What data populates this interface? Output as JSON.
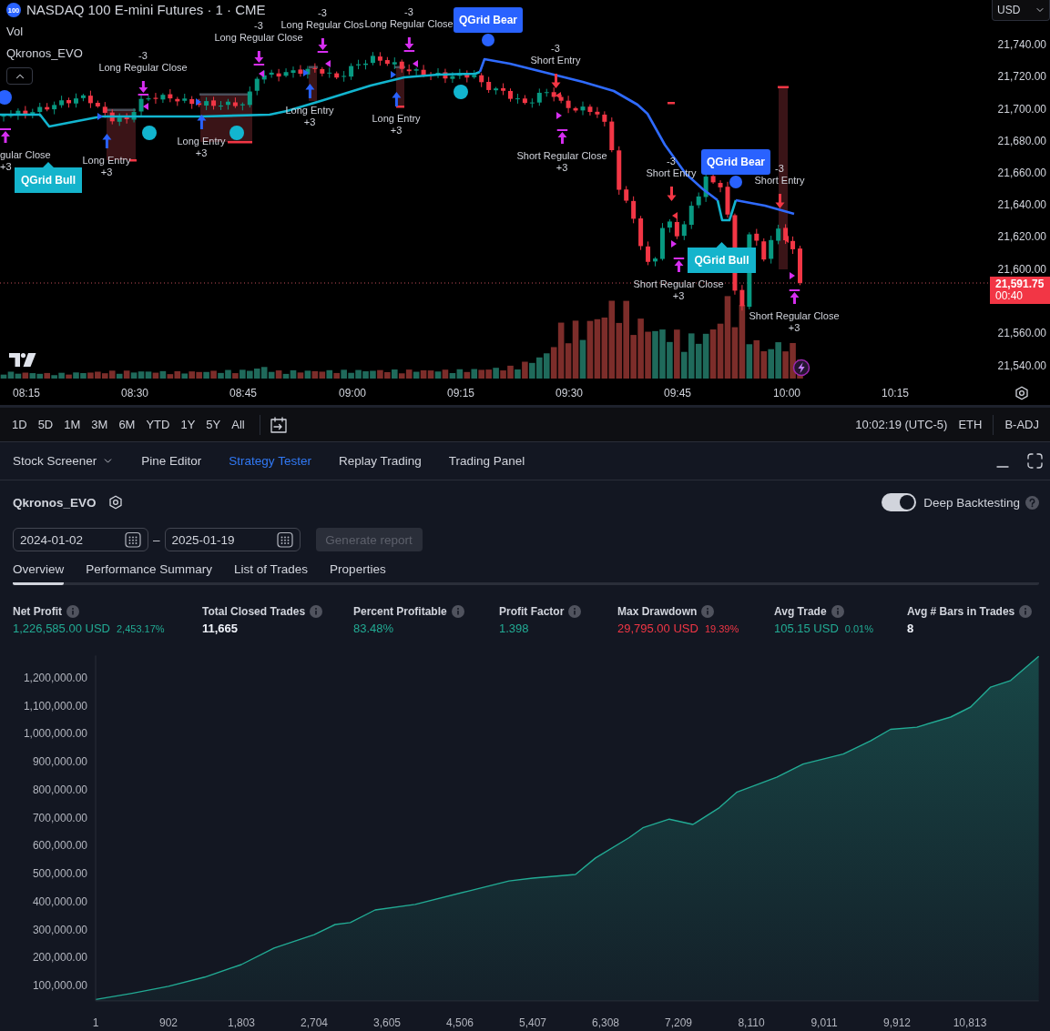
{
  "chart": {
    "symbol_badge": "100",
    "title": "NASDAQ 100 E-mini Futures · 1 · CME",
    "indicators": [
      "Vol",
      "Qkronos_EVO"
    ],
    "legend_toggle": {
      "expanded": true
    },
    "currency": "USD",
    "annotations": [
      {
        "kind": "long_close",
        "qty": "-3",
        "label": "Long Regular Clos"
      },
      {
        "kind": "long_close",
        "qty": "-3",
        "label": "Long Regular Close"
      },
      {
        "kind": "long_close",
        "qty": "-3",
        "label": "Long Regular Close"
      },
      {
        "kind": "short_entry",
        "qty": "-3",
        "label": "Short Entry"
      },
      {
        "kind": "long_close",
        "qty": "-3",
        "label": "Long Regular Close"
      },
      {
        "kind": "long_entry",
        "qty": "+3",
        "label": "Long Entry"
      },
      {
        "kind": "long_entry",
        "qty": "+3",
        "label": "Long Entry"
      },
      {
        "kind": "long_entry",
        "qty": "+3",
        "label": "Long Entry"
      },
      {
        "kind": "short_close",
        "qty": "+3",
        "label": "gular Close"
      },
      {
        "kind": "long_entry",
        "qty": "+3",
        "label": "Long Entry"
      },
      {
        "kind": "short_close",
        "qty": "+3",
        "label": "Short Regular Close"
      },
      {
        "kind": "short_entry",
        "qty": "-3",
        "label": "Short Entry"
      },
      {
        "kind": "short_entry",
        "qty": "-3",
        "label": "Short Entry"
      },
      {
        "kind": "short_close",
        "qty": "+3",
        "label": "Short Regular Close"
      },
      {
        "kind": "short_close",
        "qty": "+3",
        "label": "Short Regular Close"
      }
    ],
    "signals": [
      {
        "kind": "bear",
        "label": "QGrid Bear"
      },
      {
        "kind": "bear",
        "label": "QGrid Bear"
      },
      {
        "kind": "bull",
        "label": "QGrid Bull"
      },
      {
        "kind": "bull",
        "label": "QGrid Bull"
      }
    ],
    "price_axis": [
      "21,740.00",
      "21,720.00",
      "21,700.00",
      "21,680.00",
      "21,660.00",
      "21,640.00",
      "21,620.00",
      "21,600.00",
      "21,560.00",
      "21,540.00"
    ],
    "last_price": {
      "price": "21,591.75",
      "countdown": "00:40"
    },
    "time_axis": [
      "08:15",
      "08:30",
      "08:45",
      "09:00",
      "09:15",
      "09:30",
      "09:45",
      "10:00",
      "10:15"
    ]
  },
  "toolbar": {
    "ranges": [
      "1D",
      "5D",
      "1M",
      "3M",
      "6M",
      "YTD",
      "1Y",
      "5Y",
      "All"
    ],
    "clock": "10:02:19 (UTC-5)",
    "session": "ETH",
    "adjustment": "B-ADJ"
  },
  "panel_tabs": [
    {
      "label": "Stock Screener",
      "dropdown": true,
      "selected": false
    },
    {
      "label": "Pine Editor",
      "dropdown": false,
      "selected": false
    },
    {
      "label": "Strategy Tester",
      "dropdown": false,
      "selected": true
    },
    {
      "label": "Replay Trading",
      "dropdown": false,
      "selected": false
    },
    {
      "label": "Trading Panel",
      "dropdown": false,
      "selected": false
    }
  ],
  "strategy": {
    "name": "Qkronos_EVO",
    "deep_backtesting": {
      "label": "Deep Backtesting",
      "on": true
    },
    "date_from": "2024-01-02",
    "separator": "–",
    "date_to": "2025-01-19",
    "generate_button": {
      "label": "Generate report",
      "disabled": true
    },
    "tabs": [
      {
        "label": "Overview",
        "selected": true
      },
      {
        "label": "Performance Summary",
        "selected": false
      },
      {
        "label": "List of Trades",
        "selected": false
      },
      {
        "label": "Properties",
        "selected": false
      }
    ],
    "metrics": [
      {
        "label": "Net Profit",
        "kind": "gain",
        "value": "1,226,585.00 USD",
        "percent": "2,453.17%"
      },
      {
        "label": "Total Closed Trades",
        "kind": "count",
        "value": "11,665"
      },
      {
        "label": "Percent Profitable",
        "kind": "gain",
        "value": "83.48%"
      },
      {
        "label": "Profit Factor",
        "kind": "gain",
        "value": "1.398"
      },
      {
        "label": "Max Drawdown",
        "kind": "loss",
        "value": "29,795.00 USD",
        "percent": "19.39%"
      },
      {
        "label": "Avg Trade",
        "kind": "gain",
        "value": "105.15 USD",
        "percent": "0.01%"
      },
      {
        "label": "Avg # Bars in Trades",
        "kind": "count",
        "value": "8"
      }
    ],
    "equity": {
      "chart_data": {
        "type": "area",
        "x": [
          1,
          450,
          902,
          1350,
          1803,
          2207,
          2704,
          2962,
          3150,
          3457,
          3953,
          4617,
          5113,
          5407,
          5935,
          6183,
          6600,
          6769,
          7095,
          7388,
          7715,
          7929,
          8424,
          8751,
          9247,
          9585,
          9832,
          10158,
          10575,
          10822,
          11070,
          11317,
          11665
        ],
        "series": [
          {
            "color": "#22ab94",
            "values": [
              50000,
              72000,
              97000,
              130000,
              175000,
              234000,
              282000,
              318000,
              325000,
              370000,
              390000,
              438000,
              474000,
              484000,
              497000,
              556000,
              629000,
              664000,
              695000,
              676000,
              736000,
              791000,
              845000,
              892000,
              928000,
              975000,
              1016000,
              1024000,
              1060000,
              1096000,
              1167000,
              1191000,
              1277000
            ]
          }
        ],
        "xlim": [
          1,
          11665
        ],
        "ylim": [
          45000,
          1280000
        ],
        "xticks": [
          {
            "value": 1,
            "label": "1"
          },
          {
            "value": 902,
            "label": "902"
          },
          {
            "value": 1803,
            "label": "1,803"
          },
          {
            "value": 2704,
            "label": "2,704"
          },
          {
            "value": 3605,
            "label": "3,605"
          },
          {
            "value": 4506,
            "label": "4,506"
          },
          {
            "value": 5407,
            "label": "5,407"
          },
          {
            "value": 6308,
            "label": "6,308"
          },
          {
            "value": 7209,
            "label": "7,209"
          },
          {
            "value": 8110,
            "label": "8,110"
          },
          {
            "value": 9011,
            "label": "9,011"
          },
          {
            "value": 9912,
            "label": "9,912"
          },
          {
            "value": 10813,
            "label": "10,813"
          }
        ],
        "yticks": [
          {
            "value": 100000,
            "label": "100,000.00"
          },
          {
            "value": 200000,
            "label": "200,000.00"
          },
          {
            "value": 300000,
            "label": "300,000.00"
          },
          {
            "value": 400000,
            "label": "400,000.00"
          },
          {
            "value": 500000,
            "label": "500,000.00"
          },
          {
            "value": 600000,
            "label": "600,000.00"
          },
          {
            "value": 700000,
            "label": "700,000.00"
          },
          {
            "value": 800000,
            "label": "800,000.00"
          },
          {
            "value": 900000,
            "label": "900,000.00"
          },
          {
            "value": 1000000,
            "label": "1,000,000.00"
          },
          {
            "value": 1100000,
            "label": "1,100,000.00"
          },
          {
            "value": 1200000,
            "label": "1,200,000.00"
          }
        ]
      }
    }
  }
}
